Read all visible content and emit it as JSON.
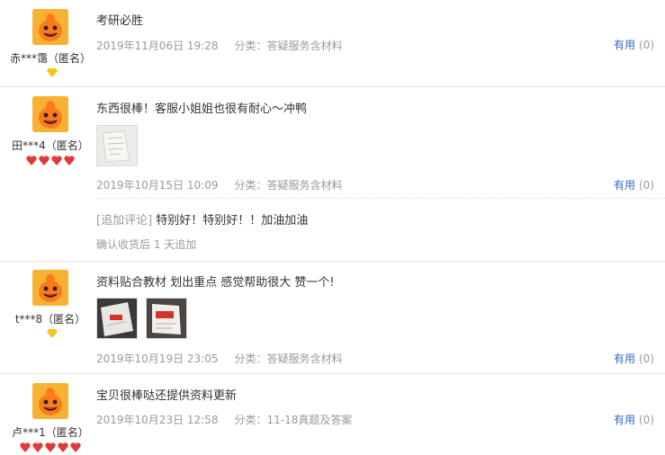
{
  "reviews": [
    {
      "user": "赤***霭（匿名）",
      "content": "考研必胜",
      "date": "2019年11月06日 19:28",
      "category": "分类：答疑服务含材料",
      "useful_label": "有用",
      "useful_count": "(0)",
      "badge": "diamond-gold",
      "badge_count": 1
    },
    {
      "user": "田***4（匿名）",
      "content": "东西很棒！客服小姐姐也很有耐心～冲鸭",
      "date": "2019年10月15日 10:09",
      "category": "分类：答疑服务含材料",
      "useful_label": "有用",
      "useful_count": "(0)",
      "append_tag": "[追加评论]",
      "append_text": " 特别好！特别好！！加油加油",
      "append_meta": "确认收货后 1 天追加",
      "badge": "heart-red",
      "badge_count": 4,
      "photos": 1
    },
    {
      "user": "t***8（匿名）",
      "content": "资料贴合教材 划出重点 感觉帮助很大 赞一个!",
      "date": "2019年10月19日 23:05",
      "category": "分类：答疑服务含材料",
      "useful_label": "有用",
      "useful_count": "(0)",
      "badge": "diamond-gold",
      "badge_count": 1,
      "photos": 2
    },
    {
      "user": "卢***1（匿名）",
      "content": "宝贝很棒哒还提供资料更新",
      "date": "2019年10月23日 12:58",
      "category": "分类：11-18真题及答案",
      "useful_label": "有用",
      "useful_count": "(0)",
      "badge": "heart-red",
      "badge_count": 5
    }
  ],
  "colors": {
    "link": "#3366cc",
    "meta": "#9a9a9a",
    "avatar": "#f6b333",
    "badge_red": "#e03a3a",
    "badge_gold": "#f5c518"
  }
}
